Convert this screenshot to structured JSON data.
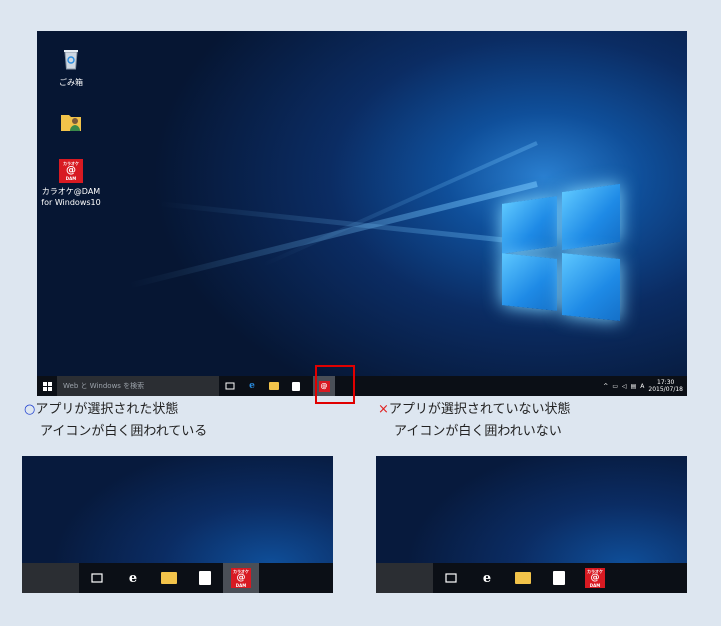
{
  "desktop": {
    "icons": [
      {
        "label": "ごみ箱"
      },
      {
        "label": ""
      },
      {
        "label": "カラオケ@DAM for Windows10",
        "badge_top": "カラオケ",
        "badge_mid": "@",
        "badge_bot": "DAM"
      }
    ],
    "search_placeholder": "Web と Windows を検索",
    "clock_time": "17:30",
    "clock_date": "2015/07/18",
    "ime_indicator": "A",
    "tray_chevron": "^"
  },
  "captions": {
    "good_mark": "○",
    "good_title": "アプリが選択された状態",
    "good_sub": "アイコンが白く囲われている",
    "bad_mark": "×",
    "bad_title": "アプリが選択されていない状態",
    "bad_sub": "アイコンが白く囲われいない"
  },
  "app_badge": {
    "top": "カラオケ",
    "mid": "@",
    "bot": "DAM"
  },
  "colors": {
    "highlight_box": "#e00000",
    "taskbar": "#0b0f16",
    "selected": "#4a4f57"
  }
}
